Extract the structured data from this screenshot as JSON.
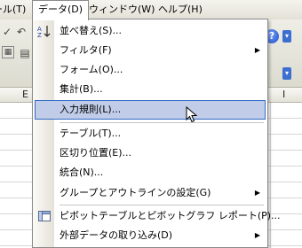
{
  "menubar": {
    "items": [
      {
        "label": "ール(T)"
      },
      {
        "label": "データ(D)"
      },
      {
        "label": "ウィンドウ(W)"
      },
      {
        "label": "ヘルプ(H)"
      }
    ]
  },
  "spreadsheet": {
    "columns": [
      "E",
      "I"
    ]
  },
  "data_menu": {
    "items": [
      {
        "label": "並べ替え(S)...",
        "icon": "sort-ascending-icon",
        "submenu": false
      },
      {
        "label": "フィルタ(F)",
        "submenu": true
      },
      {
        "label": "フォーム(O)...",
        "submenu": false
      },
      {
        "label": "集計(B)...",
        "submenu": false
      },
      {
        "label": "入力規則(L)...",
        "submenu": false,
        "highlighted": true
      },
      {
        "label": "テーブル(T)...",
        "submenu": false
      },
      {
        "label": "区切り位置(E)...",
        "submenu": false
      },
      {
        "label": "統合(N)...",
        "submenu": false
      },
      {
        "label": "グループとアウトラインの設定(G)",
        "submenu": true
      },
      {
        "label": "ピボットテーブルとピボットグラフ レポート(P)...",
        "icon": "pivot-table-icon",
        "submenu": false
      },
      {
        "label": "外部データの取り込み(D)",
        "submenu": true
      }
    ]
  },
  "colors": {
    "highlight_bg": "#c1cde8",
    "highlight_border": "#316ac5",
    "menubar_bg": "#ece9d8"
  }
}
